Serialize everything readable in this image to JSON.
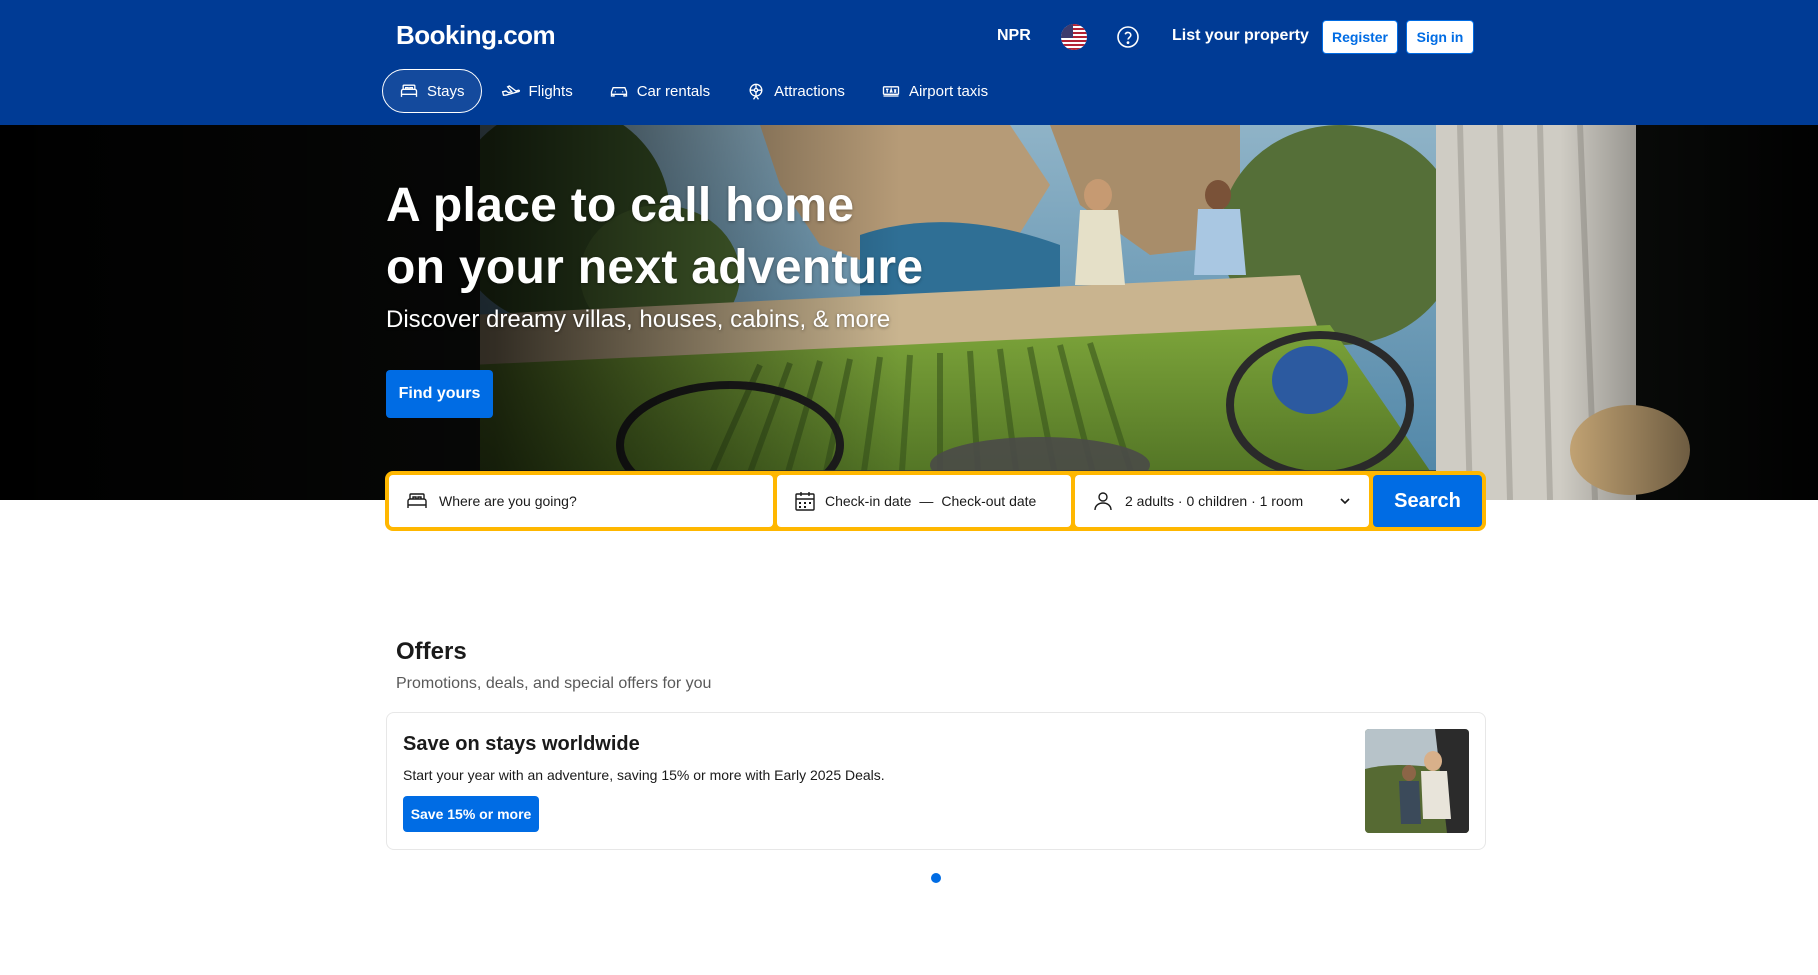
{
  "header": {
    "logo": "Booking.com",
    "currency": "NPR",
    "list_property": "List your property",
    "register_label": "Register",
    "signin_label": "Sign in"
  },
  "nav": {
    "items": [
      {
        "label": "Stays",
        "icon": "bed-icon",
        "active": true
      },
      {
        "label": "Flights",
        "icon": "plane-icon"
      },
      {
        "label": "Car rentals",
        "icon": "car-icon"
      },
      {
        "label": "Attractions",
        "icon": "attractions-icon"
      },
      {
        "label": "Airport taxis",
        "icon": "taxi-icon"
      }
    ]
  },
  "hero": {
    "title_line1": "A place to call home",
    "title_line2": "on your next adventure",
    "subtitle": "Discover dreamy villas, houses, cabins, & more",
    "cta_label": "Find yours"
  },
  "search": {
    "destination_placeholder": "Where are you going?",
    "checkin_label": "Check-in date",
    "date_separator": "—",
    "checkout_label": "Check-out date",
    "guests_label": "2 adults · 0 children · 1 room",
    "search_label": "Search"
  },
  "offers": {
    "title": "Offers",
    "subtitle": "Promotions, deals, and special offers for you",
    "card": {
      "heading": "Save on stays worldwide",
      "text": "Start your year with an adventure, saving 15% or more with Early 2025 Deals.",
      "button_label": "Save 15% or more"
    },
    "carousel": {
      "active_index": 0,
      "count": 1
    }
  },
  "colors": {
    "brand_blue": "#003b95",
    "action_blue": "#006ce4",
    "search_border": "#ffb700"
  }
}
